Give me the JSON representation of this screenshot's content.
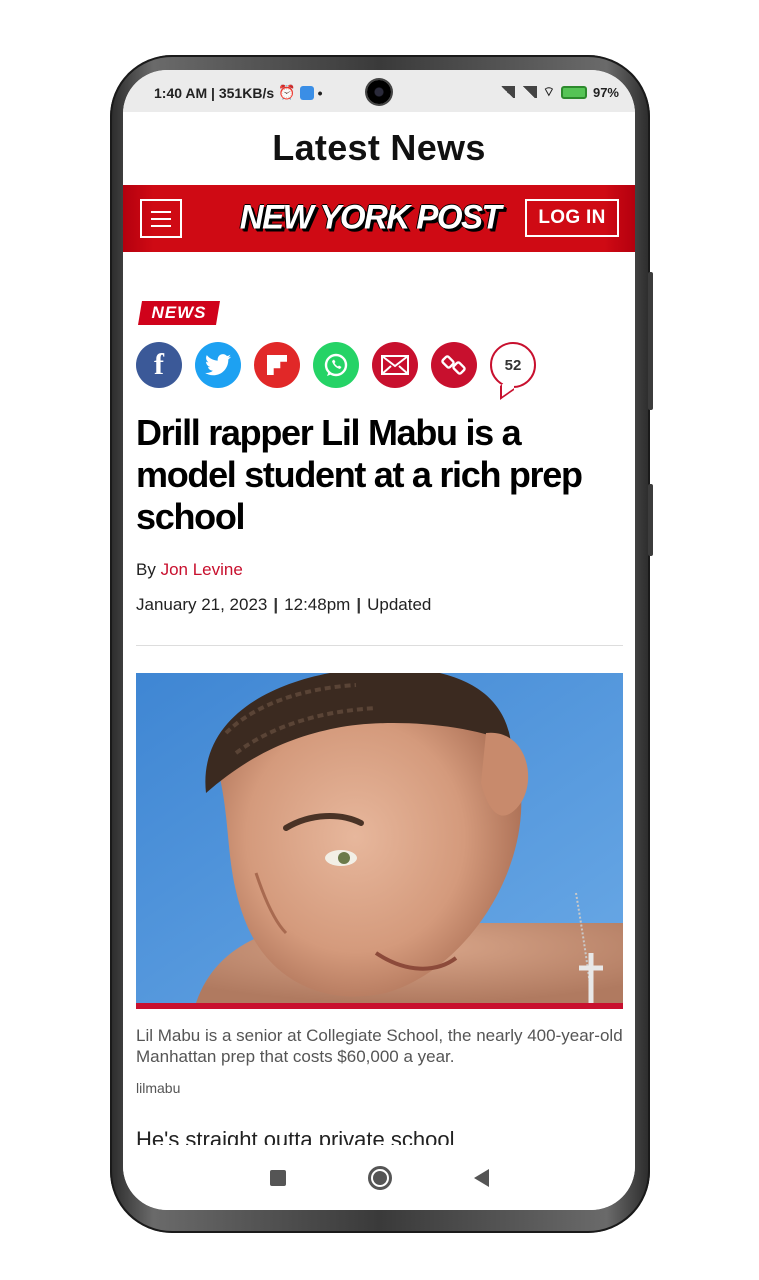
{
  "status_bar": {
    "time_speed": "1:40 AM | 351KB/s",
    "dot": "•",
    "battery": "97%"
  },
  "app_bar": {
    "title": "Latest News"
  },
  "site_header": {
    "logo_text": "NEW YORK POST",
    "login_label": "LOG IN"
  },
  "article": {
    "section": "NEWS",
    "share": {
      "facebook_glyph": "f",
      "comment_count": "52"
    },
    "headline": "Drill rapper Lil Mabu is a model student at a rich prep school",
    "byline_prefix": "By",
    "author": "Jon Levine",
    "date": "January 21, 2023",
    "separator": "|",
    "time": "12:48pm",
    "updated_label": "Updated",
    "caption": "Lil Mabu is a senior at Collegiate School, the nearly 400-year-old Manhattan prep that costs $60,000 a year.",
    "photo_credit": "lilmabu",
    "body_first_line": "He's straight outta private school"
  },
  "colors": {
    "brand_red": "#cf0a14",
    "facebook": "#3b5998",
    "twitter": "#1da1f2",
    "flipboard": "#e12828",
    "whatsapp": "#25d366",
    "email": "#c8102e",
    "link": "#c8102e"
  }
}
